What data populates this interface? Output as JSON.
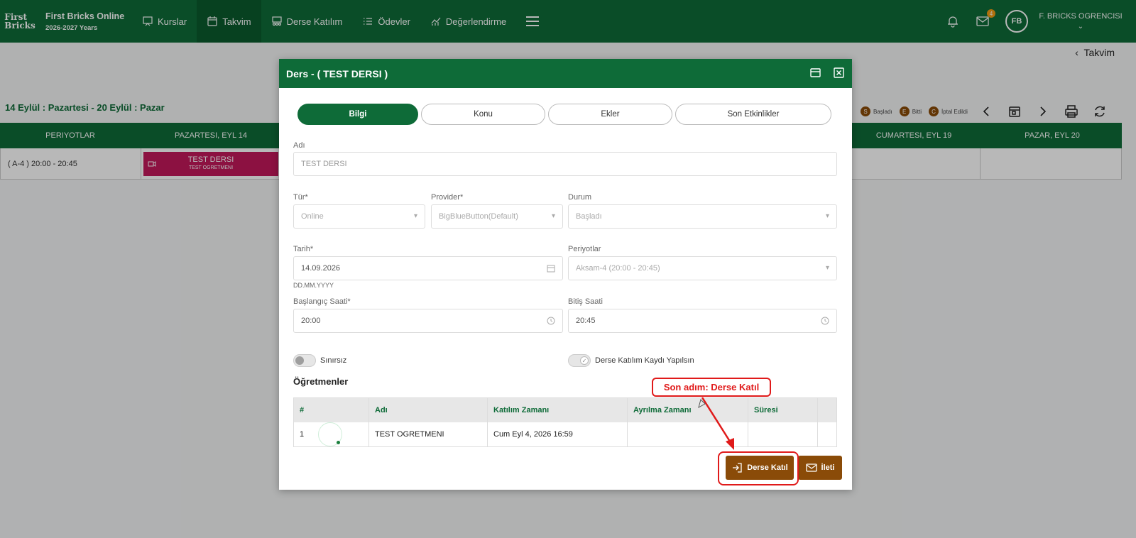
{
  "topbar": {
    "logo_line1": "First",
    "logo_line2": "Bricks",
    "brand_title": "First Bricks Online",
    "brand_sub": "2026-2027 Years",
    "nav": [
      {
        "label": "Kurslar",
        "icon": "presentation-icon"
      },
      {
        "label": "Takvim",
        "icon": "calendar-icon",
        "active": true
      },
      {
        "label": "Derse Katılım",
        "icon": "attendance-icon"
      },
      {
        "label": "Ödevler",
        "icon": "list-icon"
      },
      {
        "label": "Değerlendirme",
        "icon": "chart-icon"
      }
    ],
    "mail_badge": "4",
    "avatar_initials": "FB",
    "user_name": "F. BRICKS OGRENCISI"
  },
  "page": {
    "breadcrumb": "Takvim",
    "week_label": "14 Eylül : Pazartesi - 20 Eylül : Pazar",
    "legend": [
      {
        "letter": "S",
        "label": "Başladı"
      },
      {
        "letter": "E",
        "label": "Bitti"
      },
      {
        "letter": "C",
        "label": "İptal Edildi"
      }
    ],
    "columns": [
      "PERIYOTLAR",
      "PAZARTESI, EYL 14",
      "CUMARTESI, EYL 19",
      "PAZAR, EYL 20"
    ],
    "period": "( A-4 ) 20:00 - 20:45",
    "event_title": "TEST DERSI",
    "event_sub": "TEST OGRETMENI"
  },
  "modal": {
    "title": "Ders - ( TEST DERSI )",
    "tabs": [
      "Bilgi",
      "Konu",
      "Ekler",
      "Son Etkinlikler"
    ],
    "name_label": "Adı",
    "name_value": "TEST DERSI",
    "type_label": "Tür*",
    "type_value": "Online",
    "provider_label": "Provider*",
    "provider_value": "BigBlueButton(Default)",
    "status_label": "Durum",
    "status_value": "Başladı",
    "date_label": "Tarih*",
    "date_value": "14.09.2026",
    "date_hint": "DD.MM.YYYY",
    "period_label": "Periyotlar",
    "period_value": "Aksam-4 (20:00 - 20:45)",
    "start_label": "Başlangıç Saati*",
    "start_value": "20:00",
    "end_label": "Bitiş Saati",
    "end_value": "20:45",
    "unlimited_label": "Sınırsız",
    "attendance_label": "Derse Katılım Kaydı Yapılsın",
    "teachers_title": "Öğretmenler",
    "teachers_columns": [
      "#",
      "Adı",
      "Katılım Zamanı",
      "Ayrılma Zamanı",
      "Süresi"
    ],
    "teachers_rows": [
      {
        "no": "1",
        "name": "TEST OGRETMENI",
        "joined": "Cum Eyl 4, 2026 16:59",
        "left": "",
        "duration": ""
      }
    ],
    "join_button": "Derse Katıl",
    "message_button": "İleti"
  },
  "callout": "Son adım: Derse Katıl"
}
